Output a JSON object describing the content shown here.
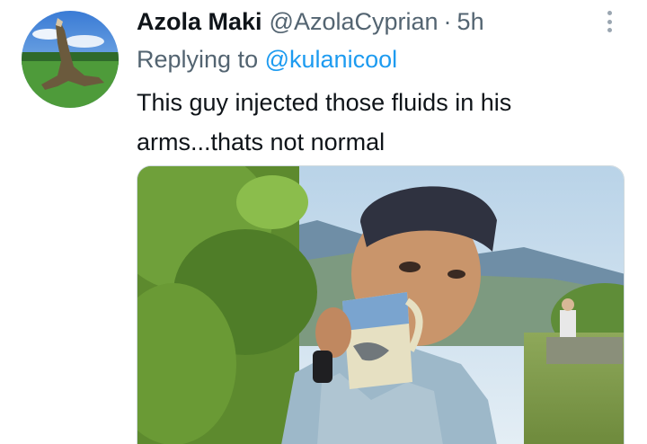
{
  "tweet": {
    "display_name": "Azola Maki",
    "handle": "@AzolaCyprian",
    "separator": "·",
    "time": "5h",
    "replying_prefix": "Replying to",
    "replying_to": "@kulanicool",
    "text": "This guy injected those fluids in his arms...thats not normal"
  },
  "icons": {
    "more": "more-vertical-icon"
  },
  "colors": {
    "link": "#1d9bf0",
    "secondary_text": "#536471",
    "primary_text": "#0f1419"
  }
}
